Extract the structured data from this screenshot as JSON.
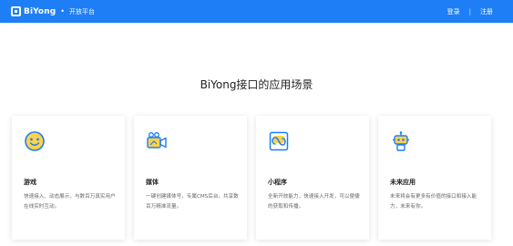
{
  "header": {
    "brand": "BiYong",
    "subtitle": "开放平台",
    "login_label": "登录",
    "separator": "|",
    "register_label": "注册",
    "accent_color": "#1e7ef5"
  },
  "section_title": "BiYong接口的应用场景",
  "cards": [
    {
      "icon": "smiley-face-icon",
      "title": "游戏",
      "description": "快速接入、动态展示，与数百万真实用户在线实时互动。"
    },
    {
      "icon": "video-camera-icon",
      "title": "媒体",
      "description": "一键创建媒体号，专属CMS后台，共享数百万精准流量。"
    },
    {
      "icon": "link-app-icon",
      "title": "小程序",
      "description": "全新开放能力，快速接入开发，可以便捷的获取和传播。"
    },
    {
      "icon": "robot-icon",
      "title": "未来应用",
      "description": "未来将会有更多有价值的接口和接入能力，未来有你。"
    }
  ]
}
